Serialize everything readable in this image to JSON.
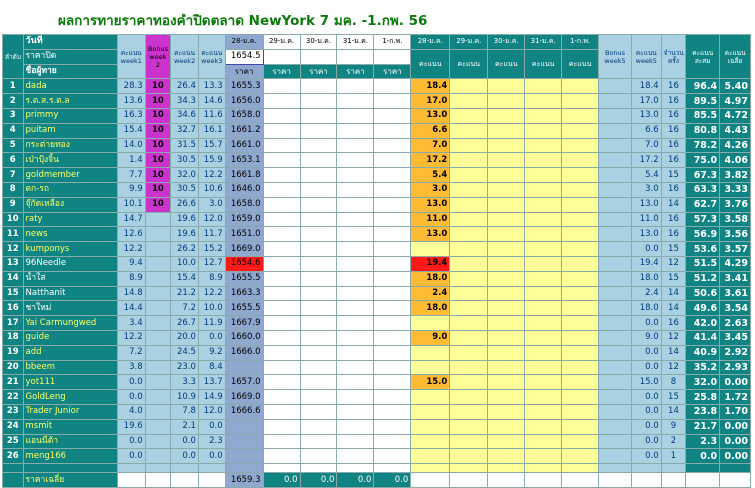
{
  "title": "ผลการทายราคาทองคำปิดตลาด NewYork 7 มค. -1.กพ. 56",
  "header": {
    "row1": [
      "ลำดับ",
      "วันที่",
      "คะแนน week1",
      "Bonus week 2",
      "คะแนน week2",
      "คะแนน week3",
      "28-ม.ค.",
      "29-ม.ค.",
      "30-ม.ค.",
      "31-ม.ค.",
      "1-ก.พ.",
      "28-ม.ค.",
      "29-ม.ค.",
      "30-ม.ค.",
      "31-ม.ค.",
      "1-ก.พ.",
      "Bonus week5",
      "คะแนน week5",
      "จำนวน ครั้ง",
      "คะแนน สะสม",
      "คะแนน เฉลี่ย"
    ],
    "closing_label": "ราคาปิด",
    "closing_price": "1654.5",
    "name_label": "ชื่อผู้ทาย",
    "price_label": "ราคา",
    "score_label": "คะแนน"
  },
  "rows": [
    {
      "n": "1",
      "name": "dada",
      "w1": "28.3",
      "bonus": "10",
      "w2": "26.4",
      "w3": "13.3",
      "p": "1655.3",
      "s": "18.4",
      "w5": "18.4",
      "cnt": "16",
      "tot": "96.4",
      "avg": "5.40",
      "nc": "yname"
    },
    {
      "n": "2",
      "name": "ร.ต.ส.ร.ต.ล",
      "w1": "13.6",
      "bonus": "10",
      "w2": "34.3",
      "w3": "14.6",
      "p": "1656.0",
      "s": "17.0",
      "w5": "17.0",
      "cnt": "16",
      "tot": "89.5",
      "avg": "4.97",
      "nc": "yname"
    },
    {
      "n": "3",
      "name": "primmy",
      "w1": "16.3",
      "bonus": "10",
      "w2": "34.6",
      "w3": "11.6",
      "p": "1658.0",
      "s": "13.0",
      "w5": "13.0",
      "cnt": "16",
      "tot": "85.5",
      "avg": "4.72",
      "nc": "yname"
    },
    {
      "n": "4",
      "name": "puitam",
      "w1": "15.4",
      "bonus": "10",
      "w2": "32.7",
      "w3": "16.1",
      "p": "1661.2",
      "s": "6.6",
      "w5": "6.6",
      "cnt": "16",
      "tot": "80.8",
      "avg": "4.43",
      "nc": "yname"
    },
    {
      "n": "5",
      "name": "กระต่ายทอง",
      "w1": "14.0",
      "bonus": "10",
      "w2": "31.5",
      "w3": "15.7",
      "p": "1661.0",
      "s": "7.0",
      "w5": "7.0",
      "cnt": "16",
      "tot": "78.2",
      "avg": "4.26",
      "nc": "yname"
    },
    {
      "n": "6",
      "name": "เป่าปุ้งจิ้น",
      "w1": "1.4",
      "bonus": "10",
      "w2": "30.5",
      "w3": "15.9",
      "p": "1653.1",
      "s": "17.2",
      "w5": "17.2",
      "cnt": "16",
      "tot": "75.0",
      "avg": "4.06",
      "nc": "yname"
    },
    {
      "n": "7",
      "name": "goldmember",
      "w1": "7.7",
      "bonus": "10",
      "w2": "32.0",
      "w3": "12.2",
      "p": "1661.8",
      "s": "5.4",
      "w5": "5.4",
      "cnt": "15",
      "tot": "67.3",
      "avg": "3.82",
      "nc": "yname"
    },
    {
      "n": "8",
      "name": "ตก-รถ",
      "w1": "9.9",
      "bonus": "10",
      "w2": "30.5",
      "w3": "10.6",
      "p": "1646.0",
      "s": "3.0",
      "w5": "3.0",
      "cnt": "16",
      "tot": "63.3",
      "avg": "3.33",
      "nc": "yname"
    },
    {
      "n": "9",
      "name": "จุ๊กัดเหลือง",
      "w1": "10.1",
      "bonus": "10",
      "w2": "26.6",
      "w3": "3.0",
      "p": "1658.0",
      "s": "13.0",
      "w5": "13.0",
      "cnt": "14",
      "tot": "62.7",
      "avg": "3.76",
      "nc": "yname"
    },
    {
      "n": "10",
      "name": "raty",
      "w1": "14.7",
      "bonus": "",
      "w2": "19.6",
      "w3": "12.0",
      "p": "1659.0",
      "s": "11.0",
      "w5": "11.0",
      "cnt": "16",
      "tot": "57.3",
      "avg": "3.58",
      "nc": "yname"
    },
    {
      "n": "11",
      "name": "news",
      "w1": "12.6",
      "bonus": "",
      "w2": "19.6",
      "w3": "11.7",
      "p": "1651.0",
      "s": "13.0",
      "w5": "13.0",
      "cnt": "16",
      "tot": "56.9",
      "avg": "3.56",
      "nc": "yname"
    },
    {
      "n": "12",
      "name": "kumponys",
      "w1": "12.2",
      "bonus": "",
      "w2": "26.2",
      "w3": "15.2",
      "p": "1669.0",
      "s": "",
      "w5": "0.0",
      "cnt": "15",
      "tot": "53.6",
      "avg": "3.57",
      "nc": "yname"
    },
    {
      "n": "13",
      "name": "96Needle",
      "w1": "9.4",
      "bonus": "",
      "w2": "10.0",
      "w3": "12.7",
      "p": "1654.6",
      "s": "19.4",
      "w5": "19.4",
      "cnt": "12",
      "tot": "51.5",
      "avg": "4.29",
      "nc": "wname",
      "hl": "1"
    },
    {
      "n": "14",
      "name": "น้ำใส",
      "w1": "8.9",
      "bonus": "",
      "w2": "15.4",
      "w3": "8.9",
      "p": "1655.5",
      "s": "18.0",
      "w5": "18.0",
      "cnt": "15",
      "tot": "51.2",
      "avg": "3.41",
      "nc": "wname"
    },
    {
      "n": "15",
      "name": "Natthanit",
      "w1": "14.8",
      "bonus": "",
      "w2": "21.2",
      "w3": "12.2",
      "p": "1663.3",
      "s": "2.4",
      "w5": "2.4",
      "cnt": "14",
      "tot": "50.6",
      "avg": "3.61",
      "nc": "wname"
    },
    {
      "n": "16",
      "name": "ชาใหม่",
      "w1": "14.4",
      "bonus": "",
      "w2": "7.2",
      "w3": "10.0",
      "p": "1655.5",
      "s": "18.0",
      "w5": "18.0",
      "cnt": "14",
      "tot": "49.6",
      "avg": "3.54",
      "nc": "wname"
    },
    {
      "n": "17",
      "name": "Yai Carmungwed",
      "w1": "3.4",
      "bonus": "",
      "w2": "26.7",
      "w3": "11.9",
      "p": "1667.9",
      "s": "",
      "w5": "0.0",
      "cnt": "16",
      "tot": "42.0",
      "avg": "2.63",
      "nc": "yname"
    },
    {
      "n": "18",
      "name": "guide",
      "w1": "12.2",
      "bonus": "",
      "w2": "20.0",
      "w3": "0.0",
      "p": "1660.0",
      "s": "9.0",
      "w5": "9.0",
      "cnt": "12",
      "tot": "41.4",
      "avg": "3.45",
      "nc": "yname"
    },
    {
      "n": "19",
      "name": "add",
      "w1": "7.2",
      "bonus": "",
      "w2": "24.5",
      "w3": "9.2",
      "p": "1666.0",
      "s": "",
      "w5": "0.0",
      "cnt": "14",
      "tot": "40.9",
      "avg": "2.92",
      "nc": "yname"
    },
    {
      "n": "20",
      "name": "bbeem",
      "w1": "3.8",
      "bonus": "",
      "w2": "23.0",
      "w3": "8.4",
      "p": "",
      "s": "",
      "w5": "0.0",
      "cnt": "12",
      "tot": "35.2",
      "avg": "2.93",
      "nc": "yname"
    },
    {
      "n": "21",
      "name": "yot111",
      "w1": "0.0",
      "bonus": "",
      "w2": "3.3",
      "w3": "13.7",
      "p": "1657.0",
      "s": "15.0",
      "w5": "15.0",
      "cnt": "8",
      "tot": "32.0",
      "avg": "0.00",
      "nc": "yname"
    },
    {
      "n": "22",
      "name": "GoldLeng",
      "w1": "0.0",
      "bonus": "",
      "w2": "10.9",
      "w3": "14.9",
      "p": "1669.0",
      "s": "",
      "w5": "0.0",
      "cnt": "15",
      "tot": "25.8",
      "avg": "1.72",
      "nc": "yname"
    },
    {
      "n": "23",
      "name": "Trader Junior",
      "w1": "4.0",
      "bonus": "",
      "w2": "7.8",
      "w3": "12.0",
      "p": "1666.6",
      "s": "",
      "w5": "0.0",
      "cnt": "14",
      "tot": "23.8",
      "avg": "1.70",
      "nc": "yname"
    },
    {
      "n": "24",
      "name": "msmit",
      "w1": "19.6",
      "bonus": "",
      "w2": "2.1",
      "w3": "0.0",
      "p": "",
      "s": "",
      "w5": "0.0",
      "cnt": "9",
      "tot": "21.7",
      "avg": "0.00",
      "nc": "yname"
    },
    {
      "n": "25",
      "name": "แอนนี่ต้า",
      "w1": "0.0",
      "bonus": "",
      "w2": "0.0",
      "w3": "2.3",
      "p": "",
      "s": "",
      "w5": "0.0",
      "cnt": "2",
      "tot": "2.3",
      "avg": "0.00",
      "nc": "yname"
    },
    {
      "n": "26",
      "name": "meng166",
      "w1": "0.0",
      "bonus": "",
      "w2": "0.0",
      "w3": "0.0",
      "p": "",
      "s": "",
      "w5": "0.0",
      "cnt": "1",
      "tot": "0.0",
      "avg": "0.00",
      "nc": "yname"
    }
  ],
  "footer": {
    "label": "ราคาเฉลี่ย",
    "avg_prices": [
      "1659.3",
      "0.0",
      "0.0",
      "0.0",
      "0.0"
    ]
  },
  "colors": {
    "teal": "#0f8482",
    "light_blue": "#a9d1e1",
    "magenta": "#cc33cc",
    "steel_blue": "#8fa8cf",
    "yellow": "#ffff99",
    "orange": "#ffbb33",
    "red": "#ff1a1a",
    "title_green": "#0a7a0a"
  }
}
